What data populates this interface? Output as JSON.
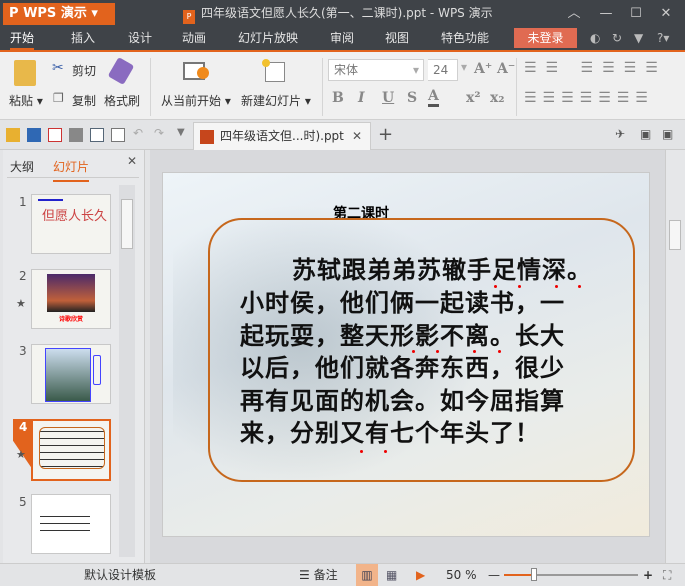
{
  "app": {
    "name": "WPS 演示",
    "title": "四年级语文但愿人长久(第一、二课时).ppt - WPS 演示"
  },
  "menu": {
    "items": [
      "开始",
      "插入",
      "设计",
      "动画",
      "幻灯片放映",
      "审阅",
      "视图",
      "特色功能"
    ],
    "login": "未登录"
  },
  "ribbon": {
    "paste": "粘贴",
    "cut": "剪切",
    "copy": "复制",
    "format_painter": "格式刷",
    "from_current": "从当前开始",
    "new_slide": "新建幻灯片",
    "font_name": "宋体",
    "font_size": "24",
    "bold": "B",
    "italic": "I",
    "underline": "U",
    "shadow": "S",
    "font_color": "A"
  },
  "doc_tab": {
    "label": "四年级语文但...时).ppt"
  },
  "left_panel": {
    "tabs": [
      "大纲",
      "幻灯片"
    ],
    "slides": [
      {
        "num": "1",
        "title": "但愿人长久"
      },
      {
        "num": "2",
        "caption": "诗歌欣赏"
      },
      {
        "num": "3"
      },
      {
        "num": "4"
      },
      {
        "num": "5"
      }
    ]
  },
  "slide": {
    "title": "第二课时",
    "lines": [
      "苏轼跟弟弟苏辙手足情深。",
      "小时侯，他们俩一起读书，一",
      "起玩耍，整天形影不离。长大",
      "以后，他们就各奔东西，很少",
      "再有见面的机会。如今屈指算",
      "来，分别又有七个年头了！"
    ]
  },
  "status": {
    "template": "默认设计模板",
    "notes": "备注",
    "zoom": "50 %",
    "zoom_percent": 50
  },
  "colors": {
    "accent": "#e2631d",
    "titlebar": "#3f4348",
    "login": "#e06b52"
  }
}
